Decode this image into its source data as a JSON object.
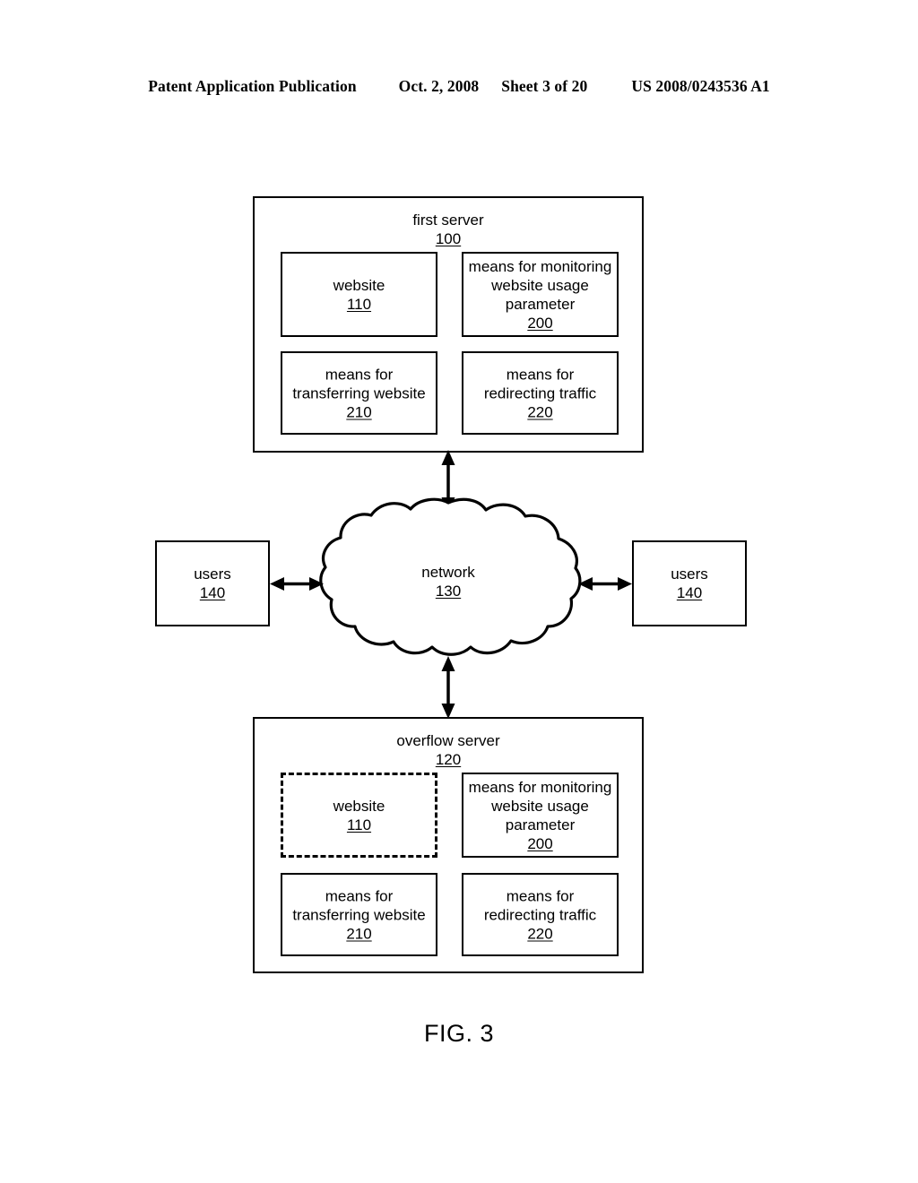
{
  "page": {
    "header": {
      "publication": "Patent Application Publication",
      "date": "Oct. 2, 2008",
      "sheet": "Sheet 3 of 20",
      "patent_number": "US 2008/0243536 A1"
    },
    "figure_caption": "FIG. 3",
    "background_color": "#ffffff",
    "line_color": "#000000"
  },
  "diagram": {
    "first_server": {
      "title": "first server",
      "ref": "100",
      "components": [
        {
          "label": "website",
          "ref": "110",
          "style": "solid"
        },
        {
          "label": "means for monitoring\nwebsite usage\nparameter",
          "line1": "means for monitoring",
          "line2": "website usage",
          "line3": "parameter",
          "ref": "200",
          "style": "solid"
        },
        {
          "line1": "means for",
          "line2": "transferring website",
          "ref": "210",
          "style": "solid"
        },
        {
          "line1": "means for",
          "line2": "redirecting traffic",
          "ref": "220",
          "style": "solid"
        }
      ]
    },
    "network": {
      "label": "network",
      "ref": "130",
      "shape": "cloud"
    },
    "users_left": {
      "label": "users",
      "ref": "140"
    },
    "users_right": {
      "label": "users",
      "ref": "140"
    },
    "overflow_server": {
      "title": "overflow server",
      "ref": "120",
      "components": [
        {
          "label": "website",
          "ref": "110",
          "style": "dashed"
        },
        {
          "line1": "means for monitoring",
          "line2": "website usage",
          "line3": "parameter",
          "ref": "200",
          "style": "solid"
        },
        {
          "line1": "means for",
          "line2": "transferring website",
          "ref": "210",
          "style": "solid"
        },
        {
          "line1": "means for",
          "line2": "redirecting traffic",
          "ref": "220",
          "style": "solid"
        }
      ]
    },
    "connections": [
      {
        "name": "first-server-to-network",
        "type": "double-arrow",
        "orientation": "vertical"
      },
      {
        "name": "users-left-to-network",
        "type": "double-arrow",
        "orientation": "horizontal"
      },
      {
        "name": "users-right-to-network",
        "type": "double-arrow",
        "orientation": "horizontal"
      },
      {
        "name": "network-to-overflow-server",
        "type": "double-arrow",
        "orientation": "vertical"
      }
    ]
  }
}
